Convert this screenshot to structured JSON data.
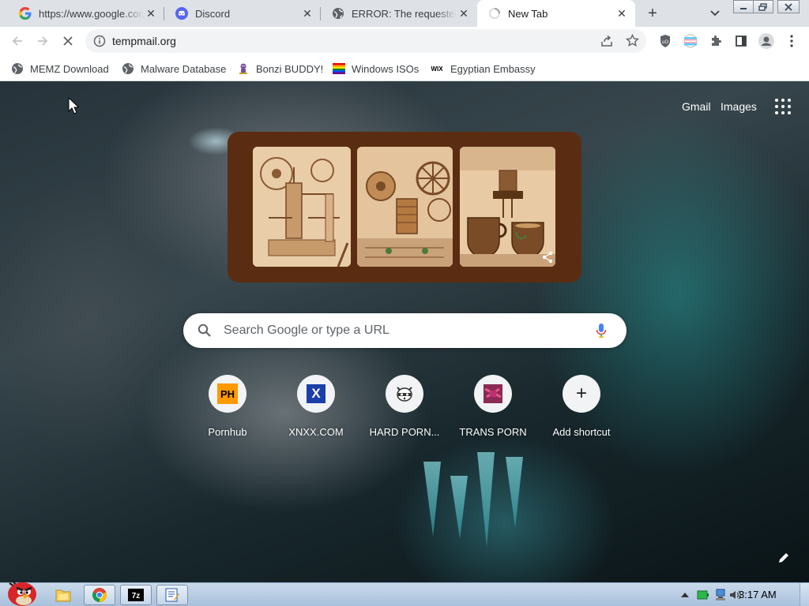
{
  "tabs": [
    {
      "title": "https://www.google.com",
      "favicon": "google-g-icon",
      "active": false
    },
    {
      "title": "Discord",
      "favicon": "discord-icon",
      "active": false
    },
    {
      "title": "ERROR: The requested URL could not be retrieved",
      "favicon": "globe-icon",
      "active": false
    },
    {
      "title": "New Tab",
      "favicon": "loading-spinner-icon",
      "active": true
    }
  ],
  "toolbar": {
    "url": "tempmail.org"
  },
  "bookmarks": [
    {
      "label": "MEMZ Download",
      "icon": "globe-icon"
    },
    {
      "label": "Malware Database",
      "icon": "globe-icon"
    },
    {
      "label": "Bonzi BUDDY!",
      "icon": "bonzi-icon"
    },
    {
      "label": "Windows ISOs",
      "icon": "rainbow-flag-icon"
    },
    {
      "label": "Egyptian Embassy",
      "icon": "wix-icon"
    }
  ],
  "ntp": {
    "gmail": "Gmail",
    "images": "Images",
    "search_placeholder": "Search Google or type a URL",
    "shortcuts": [
      {
        "label": "Pornhub",
        "icon_text": "PH"
      },
      {
        "label": "XNXX.COM",
        "icon_text": "X"
      },
      {
        "label": "HARD PORN...",
        "icon_text": ""
      },
      {
        "label": "TRANS PORN",
        "icon_text": ""
      },
      {
        "label": "Add shortcut",
        "icon_text": "+"
      }
    ]
  },
  "taskbar": {
    "clock": "3:17 AM",
    "wix_text": "WIX"
  },
  "colors": {
    "tabstrip": "#dee1e6",
    "doodle_frame": "#5a2d12",
    "ph_orange": "#ff9900",
    "xnxx_blue": "#1b3fa8"
  }
}
